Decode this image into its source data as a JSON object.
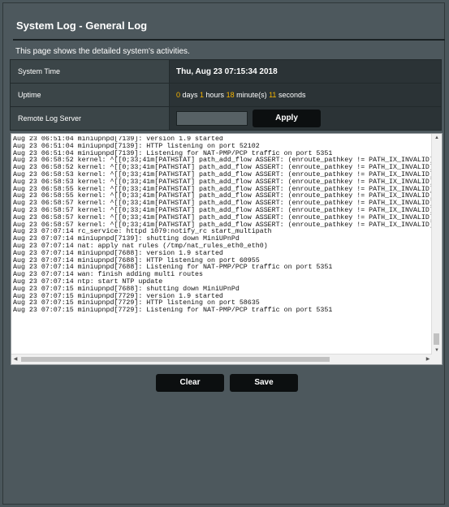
{
  "page": {
    "title": "System Log - General Log",
    "description": "This page shows the detailed system's activities."
  },
  "info": {
    "system_time_label": "System Time",
    "system_time_value": "Thu, Aug 23 07:15:34 2018",
    "uptime_label": "Uptime",
    "uptime": {
      "days": "0",
      "days_unit": " days ",
      "hours": "1",
      "hours_unit": " hours ",
      "minutes": "18",
      "minutes_unit": " minute(s) ",
      "seconds": "11",
      "seconds_unit": " seconds"
    },
    "remote_server_label": "Remote Log Server",
    "remote_server_value": "",
    "apply_label": "Apply"
  },
  "log": {
    "text": "Aug 23 06:51:04 miniupnpd[7139]: version 1.9 started\nAug 23 06:51:04 miniupnpd[7139]: HTTP listening on port 52102\nAug 23 06:51:04 miniupnpd[7139]: Listening for NAT-PMP/PCP traffic on port 5351\nAug 23 06:58:52 kernel: ^[[0;33;41m[PATHSTAT] path_add_flow ASSERT: (enroute_pathkey != PATH_IX_INVALID)\nAug 23 06:58:52 kernel: ^[[0;33;41m[PATHSTAT] path_add_flow ASSERT: (enroute_pathkey != PATH_IX_INVALID)\nAug 23 06:58:53 kernel: ^[[0;33;41m[PATHSTAT] path_add_flow ASSERT: (enroute_pathkey != PATH_IX_INVALID)\nAug 23 06:58:53 kernel: ^[[0;33;41m[PATHSTAT] path_add_flow ASSERT: (enroute_pathkey != PATH_IX_INVALID)\nAug 23 06:58:55 kernel: ^[[0;33;41m[PATHSTAT] path_add_flow ASSERT: (enroute_pathkey != PATH_IX_INVALID)\nAug 23 06:58:55 kernel: ^[[0;33;41m[PATHSTAT] path_add_flow ASSERT: (enroute_pathkey != PATH_IX_INVALID)\nAug 23 06:58:57 kernel: ^[[0;33;41m[PATHSTAT] path_add_flow ASSERT: (enroute_pathkey != PATH_IX_INVALID)\nAug 23 06:58:57 kernel: ^[[0;33;41m[PATHSTAT] path_add_flow ASSERT: (enroute_pathkey != PATH_IX_INVALID)\nAug 23 06:58:57 kernel: ^[[0;33;41m[PATHSTAT] path_add_flow ASSERT: (enroute_pathkey != PATH_IX_INVALID)\nAug 23 06:58:57 kernel: ^[[0;33;41m[PATHSTAT] path_add_flow ASSERT: (enroute_pathkey != PATH_IX_INVALID)\nAug 23 07:07:14 rc_service: httpd 1079:notify_rc start_multipath\nAug 23 07:07:14 miniupnpd[7139]: shutting down MiniUPnPd\nAug 23 07:07:14 nat: apply nat rules (/tmp/nat_rules_eth0_eth0)\nAug 23 07:07:14 miniupnpd[7688]: version 1.9 started\nAug 23 07:07:14 miniupnpd[7688]: HTTP listening on port 60955\nAug 23 07:07:14 miniupnpd[7688]: Listening for NAT-PMP/PCP traffic on port 5351\nAug 23 07:07:14 wan: finish adding multi routes\nAug 23 07:07:14 ntp: start NTP update\nAug 23 07:07:15 miniupnpd[7688]: shutting down MiniUPnPd\nAug 23 07:07:15 miniupnpd[7729]: version 1.9 started\nAug 23 07:07:15 miniupnpd[7729]: HTTP listening on port 58635\nAug 23 07:07:15 miniupnpd[7729]: Listening for NAT-PMP/PCP traffic on port 5351",
    "icons": {
      "scroll_up": "arrow-up-icon",
      "scroll_down": "arrow-down-icon",
      "scroll_left": "arrow-left-icon",
      "scroll_right": "arrow-right-icon"
    }
  },
  "actions": {
    "clear_label": "Clear",
    "save_label": "Save"
  },
  "colors": {
    "background": "#4d585d",
    "accent_yellow": "#f7b500",
    "button": "#0c0f10"
  }
}
